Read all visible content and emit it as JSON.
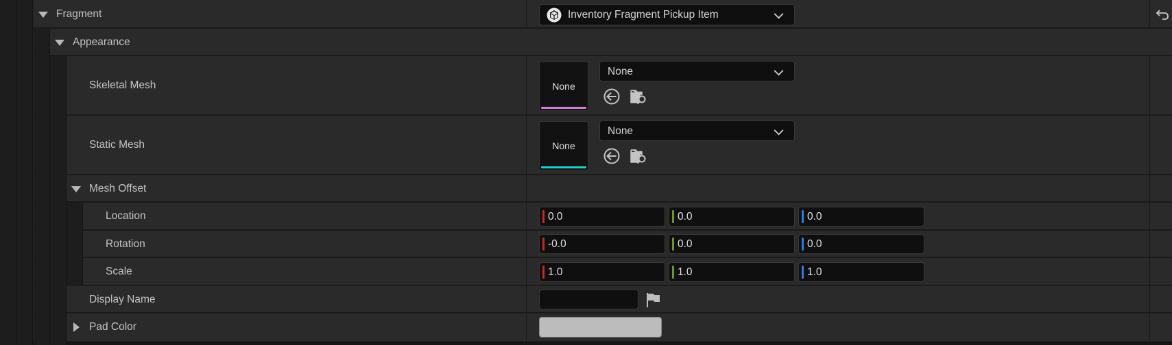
{
  "fragment": {
    "label": "Fragment",
    "value": "Inventory Fragment Pickup Item"
  },
  "appearance": {
    "label": "Appearance"
  },
  "skeletal_mesh": {
    "label": "Skeletal Mesh",
    "thumb_text": "None",
    "value": "None",
    "accent": "#d77ad8"
  },
  "static_mesh": {
    "label": "Static Mesh",
    "thumb_text": "None",
    "value": "None",
    "accent": "#1fd0d0"
  },
  "mesh_offset": {
    "label": "Mesh Offset"
  },
  "location": {
    "label": "Location",
    "x": "0.0",
    "y": "0.0",
    "z": "0.0"
  },
  "rotation": {
    "label": "Rotation",
    "x": "-0.0",
    "y": "0.0",
    "z": "0.0"
  },
  "scale": {
    "label": "Scale",
    "x": "1.0",
    "y": "1.0",
    "z": "1.0"
  },
  "display_name": {
    "label": "Display Name",
    "value": ""
  },
  "pad_color": {
    "label": "Pad Color",
    "value": "#bcbcbc"
  },
  "axis_colors": {
    "x": "#c8291c",
    "y": "#6e9a1c",
    "z": "#2a7be4"
  },
  "icons": {
    "reset": "reset-arrow-icon",
    "use_selected": "use-selected-arrow-icon",
    "browse": "browse-folder-icon",
    "localize": "localization-flag-icon",
    "class": "class-cube-icon"
  }
}
